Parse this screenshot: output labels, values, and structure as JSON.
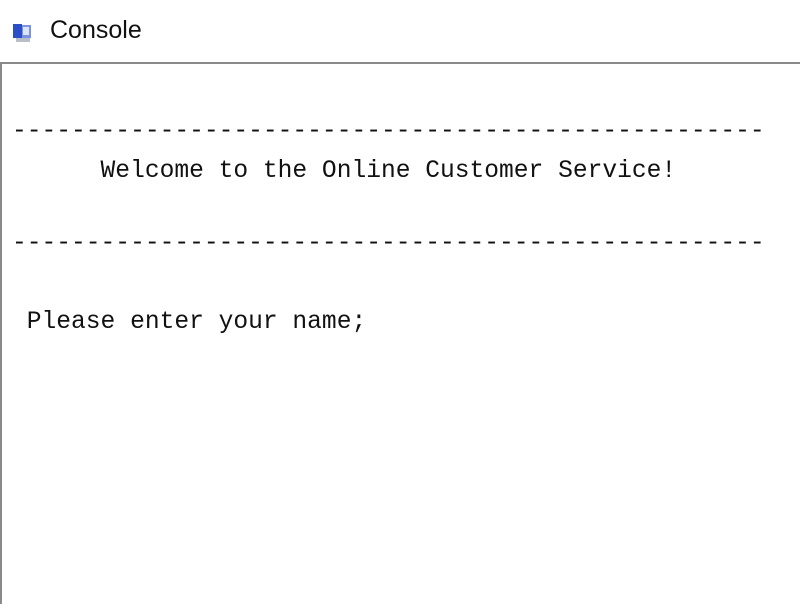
{
  "window": {
    "title": "Console",
    "icon": "console-app-icon"
  },
  "console": {
    "lines": [
      "---------------------------------------------------",
      "      Welcome to the Online Customer Service!",
      "---------------------------------------------------",
      " Please enter your name;"
    ]
  }
}
